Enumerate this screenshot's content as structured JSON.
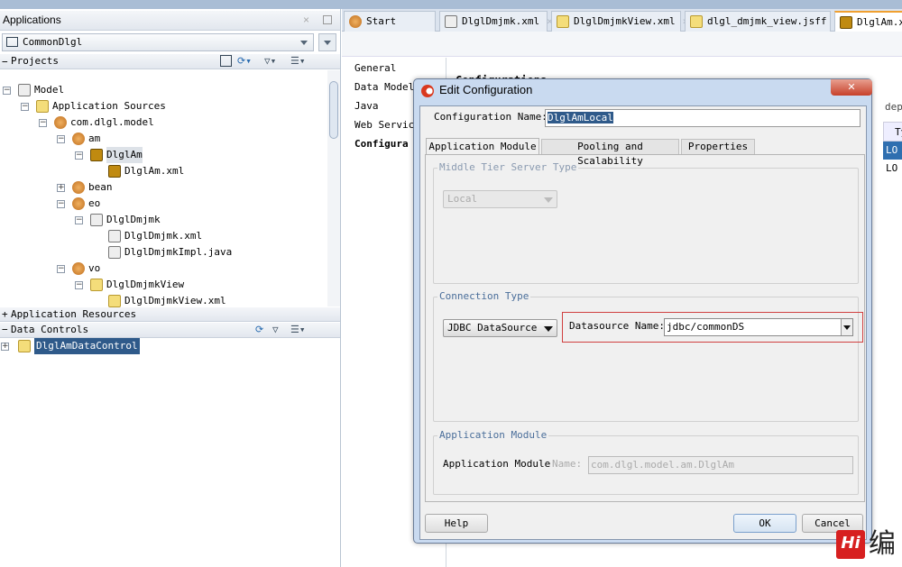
{
  "left_panel": {
    "title": "Applications",
    "app_selector": "CommonDlgl",
    "projects_label": "Projects",
    "tree": [
      {
        "label": "Model",
        "level": 0,
        "icon": "project-icon",
        "exp": "-"
      },
      {
        "label": "Application Sources",
        "level": 1,
        "icon": "folder-icon",
        "exp": "-"
      },
      {
        "label": "com.dlgl.model",
        "level": 2,
        "icon": "package-icon",
        "exp": "-"
      },
      {
        "label": "am",
        "level": 3,
        "icon": "package-icon",
        "exp": "-"
      },
      {
        "label": "DlglAm",
        "level": 4,
        "icon": "application-module-icon",
        "exp": "-",
        "selected": true
      },
      {
        "label": "DlglAm.xml",
        "level": 5,
        "icon": "application-module-icon",
        "exp": ""
      },
      {
        "label": "bean",
        "level": 3,
        "icon": "package-icon",
        "exp": "+"
      },
      {
        "label": "eo",
        "level": 3,
        "icon": "package-icon",
        "exp": "-"
      },
      {
        "label": "DlglDmjmk",
        "level": 4,
        "icon": "entity-object-icon",
        "exp": "-"
      },
      {
        "label": "DlglDmjmk.xml",
        "level": 5,
        "icon": "entity-object-icon",
        "exp": ""
      },
      {
        "label": "DlglDmjmkImpl.java",
        "level": 5,
        "icon": "java-file-icon",
        "exp": ""
      },
      {
        "label": "vo",
        "level": 3,
        "icon": "package-icon",
        "exp": "-"
      },
      {
        "label": "DlglDmjmkView",
        "level": 4,
        "icon": "view-object-icon",
        "exp": "-"
      },
      {
        "label": "DlglDmjmkView.xml",
        "level": 5,
        "icon": "view-object-icon",
        "exp": ""
      }
    ],
    "app_resources_label": "Application Resources",
    "data_controls_label": "Data Controls",
    "data_control_item": "DlglAmDataControl"
  },
  "editor_tabs": [
    {
      "label": "Start Page",
      "icon": "help-icon"
    },
    {
      "label": "DlglDmjmk.xml",
      "icon": "entity-object-icon"
    },
    {
      "label": "DlglDmjmkView.xml",
      "icon": "view-object-icon"
    },
    {
      "label": "dlgl_dmjmk_view.jsff",
      "icon": "jsff-file-icon"
    },
    {
      "label": "DlglAm.xml",
      "icon": "application-module-icon",
      "active": true
    }
  ],
  "editor_nav": [
    "General",
    "Data Model",
    "Java",
    "Web Service",
    "Configura"
  ],
  "editor_bg": {
    "heading": "Configurations",
    "depl": "depl",
    "col_header": "Ty",
    "rows": [
      "LO",
      "LO"
    ]
  },
  "dialog": {
    "title": "Edit Configuration",
    "config_name_label": "Configuration Name:",
    "config_name_value": "DlglAmLocal",
    "tabs": [
      "Application Module",
      "Pooling and Scalability",
      "Properties"
    ],
    "middle_tier_label": "Middle Tier Server Type",
    "middle_tier_value": "Local",
    "connection_type_label": "Connection Type",
    "connection_type_value": "JDBC DataSource",
    "datasource_label": "Datasource Name:",
    "datasource_value": "jdbc/commonDS",
    "app_module_group": "Application Module",
    "app_module_label": "Application Module",
    "name_label": "Name:",
    "name_value": "com.dlgl.model.am.DlglAm",
    "help": "Help",
    "ok": "OK",
    "cancel": "Cancel"
  },
  "colors": {
    "selection": "#2f5a8a",
    "highlight_border": "#d04040",
    "accent": "#4a6e9a"
  }
}
